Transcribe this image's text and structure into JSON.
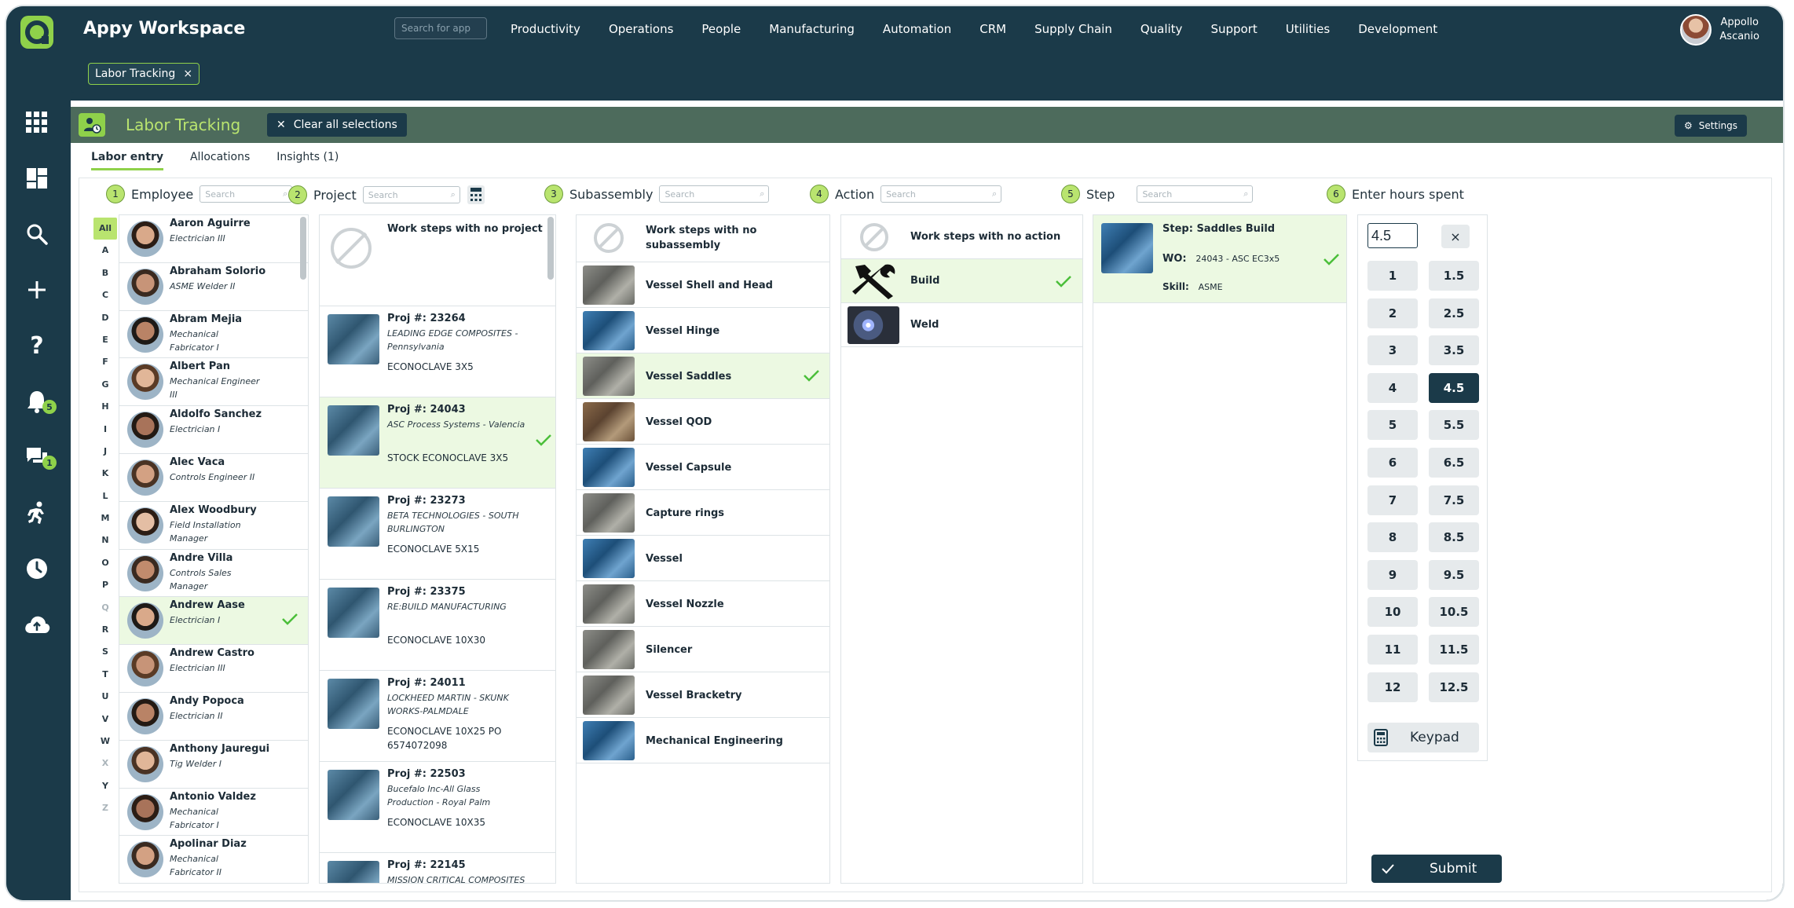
{
  "app": {
    "title": "Appy Workspace",
    "search_placeholder": "Search for app",
    "nav": [
      "Productivity",
      "Operations",
      "People",
      "Manufacturing",
      "Automation",
      "CRM",
      "Supply Chain",
      "Quality",
      "Support",
      "Utilities",
      "Development"
    ],
    "user": {
      "first": "Appollo",
      "last": "Ascanio"
    },
    "open_tab": "Labor Tracking"
  },
  "rail": {
    "icons": [
      "apps-grid-icon",
      "dashboard-icon",
      "search-icon",
      "plus-icon",
      "help-icon",
      "bell-icon",
      "chat-icon",
      "runner-icon",
      "clock-icon",
      "cloud-upload-icon"
    ],
    "notifications_badge": "5",
    "chat_badge": "1"
  },
  "page": {
    "title": "Labor Tracking",
    "clear_label": "Clear all selections",
    "settings_label": "Settings",
    "tabs": [
      "Labor entry",
      "Allocations",
      "Insights (1)"
    ]
  },
  "columns": {
    "employee": {
      "num": "1",
      "label": "Employee",
      "placeholder": "Search"
    },
    "project": {
      "num": "2",
      "label": "Project",
      "placeholder": "Search"
    },
    "subassembly": {
      "num": "3",
      "label": "Subassembly",
      "placeholder": "Search"
    },
    "action": {
      "num": "4",
      "label": "Action",
      "placeholder": "Search"
    },
    "step": {
      "num": "5",
      "label": "Step",
      "placeholder": "Search"
    },
    "hours": {
      "num": "6",
      "label": "Enter hours spent"
    }
  },
  "alphabet": [
    "All",
    "A",
    "B",
    "C",
    "D",
    "E",
    "F",
    "G",
    "H",
    "I",
    "J",
    "K",
    "L",
    "M",
    "N",
    "O",
    "P",
    "Q",
    "R",
    "S",
    "T",
    "U",
    "V",
    "W",
    "X",
    "Y",
    "Z"
  ],
  "alphabet_dim": [
    "Q",
    "X",
    "Z"
  ],
  "employees": [
    {
      "name": "Aaron Aguirre",
      "role": "Electrician III"
    },
    {
      "name": "Abraham Solorio",
      "role": "ASME Welder II"
    },
    {
      "name": "Abram Mejia",
      "role": "Mechanical Fabricator I"
    },
    {
      "name": "Albert Pan",
      "role": "Mechanical Engineer III"
    },
    {
      "name": "Aldolfo Sanchez",
      "role": "Electrician I"
    },
    {
      "name": "Alec Vaca",
      "role": "Controls Engineer II"
    },
    {
      "name": "Alex Woodbury",
      "role": "Field Installation Manager"
    },
    {
      "name": "Andre Villa",
      "role": "Controls Sales Manager"
    },
    {
      "name": "Andrew Aase",
      "role": "Electrician I",
      "selected": true
    },
    {
      "name": "Andrew Castro",
      "role": "Electrician III"
    },
    {
      "name": "Andy Popoca",
      "role": "Electrician II"
    },
    {
      "name": "Anthony Jauregui",
      "role": "Tig Welder I"
    },
    {
      "name": "Antonio Valdez",
      "role": "Mechanical Fabricator I"
    },
    {
      "name": "Apolinar Diaz",
      "role": "Mechanical Fabricator II"
    }
  ],
  "projects": [
    {
      "label": "Work steps with no project"
    },
    {
      "num": "Proj #: 23264",
      "customer": "LEADING EDGE COMPOSITES - Pennsylvania",
      "product": "ECONOCLAVE 3X5"
    },
    {
      "num": "Proj #: 24043",
      "customer": "ASC Process Systems - Valencia",
      "product": "STOCK ECONOCLAVE 3X5",
      "selected": true
    },
    {
      "num": "Proj #: 23273",
      "customer": "BETA TECHNOLOGIES - SOUTH BURLINGTON",
      "product": "ECONOCLAVE 5X15"
    },
    {
      "num": "Proj #: 23375",
      "customer": "RE:BUILD MANUFACTURING",
      "product": "ECONOCLAVE 10X30"
    },
    {
      "num": "Proj #: 24011",
      "customer": "LOCKHEED MARTIN - SKUNK WORKS-PALMDALE",
      "product": "ECONOCLAVE 10X25 PO 6574072098"
    },
    {
      "num": "Proj #: 22503",
      "customer": "Bucefalo Inc-All Glass Production - Royal Palm",
      "product": "ECONOCLAVE 10X35"
    },
    {
      "num": "Proj #: 22145",
      "customer": "MISSION CRITICAL COMPOSITES",
      "product": ""
    }
  ],
  "subassemblies": [
    {
      "label": "Work steps with no subassembly"
    },
    {
      "label": "Vessel Shell and Head"
    },
    {
      "label": "Vessel Hinge"
    },
    {
      "label": "Vessel Saddles",
      "selected": true
    },
    {
      "label": "Vessel QOD"
    },
    {
      "label": "Vessel Capsule"
    },
    {
      "label": "Capture rings"
    },
    {
      "label": "Vessel"
    },
    {
      "label": "Vessel Nozzle"
    },
    {
      "label": "Silencer"
    },
    {
      "label": "Vessel Bracketry"
    },
    {
      "label": "Mechanical Engineering"
    }
  ],
  "actions": [
    {
      "label": "Work steps with no action"
    },
    {
      "label": "Build",
      "selected": true
    },
    {
      "label": "Weld"
    }
  ],
  "step": {
    "step_label": "Step:",
    "step_value": "Saddles Build",
    "wo_label": "WO:",
    "wo_value": "24043 - ASC EC3x5",
    "skill_label": "Skill:",
    "skill_value": "ASME"
  },
  "hours": {
    "value": "4.5",
    "clear": "×",
    "keys": [
      "1",
      "1.5",
      "2",
      "2.5",
      "3",
      "3.5",
      "4",
      "4.5",
      "5",
      "5.5",
      "6",
      "6.5",
      "7",
      "7.5",
      "8",
      "8.5",
      "9",
      "9.5",
      "10",
      "10.5",
      "11",
      "11.5",
      "12",
      "12.5"
    ],
    "selected": "4.5",
    "keypad_label": "Keypad",
    "submit_label": "Submit"
  },
  "colors": {
    "accent": "#8fd14a",
    "navy": "#1b3a49",
    "selected_row": "#ecf9e2"
  }
}
